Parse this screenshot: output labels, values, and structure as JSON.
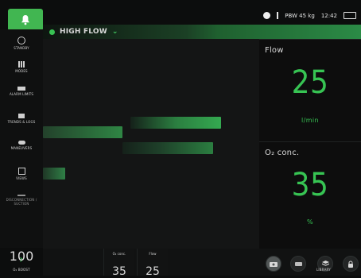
{
  "header": {
    "pbw": "PBW 45 kg",
    "time": "12:42"
  },
  "mode": {
    "label": "HIGH FLOW"
  },
  "sidebar": {
    "items": [
      {
        "label": "STANDBY"
      },
      {
        "label": "MODES"
      },
      {
        "label": "ALARM LIMITS"
      },
      {
        "label": "TRENDS & LOGS"
      },
      {
        "label": "MANEUVERS"
      },
      {
        "label": "VIEWS"
      },
      {
        "label": "DISCONNECTION / SUCTION"
      }
    ],
    "o2boost_value": "100",
    "o2boost_label": "O₂ BOOST"
  },
  "parameters": {
    "flow": {
      "title": "Flow",
      "value": "25",
      "unit": "l/min"
    },
    "o2": {
      "title": "O₂ conc.",
      "value": "35",
      "unit": "%"
    }
  },
  "bottom": {
    "o2_label": "O₂ conc.",
    "o2_value": "35",
    "flow_label": "Flow",
    "flow_value": "25",
    "library_label": "LIBRARY"
  },
  "colors": {
    "accent": "#37c453",
    "panel": "#0d0d0d",
    "graph": "#141515"
  }
}
